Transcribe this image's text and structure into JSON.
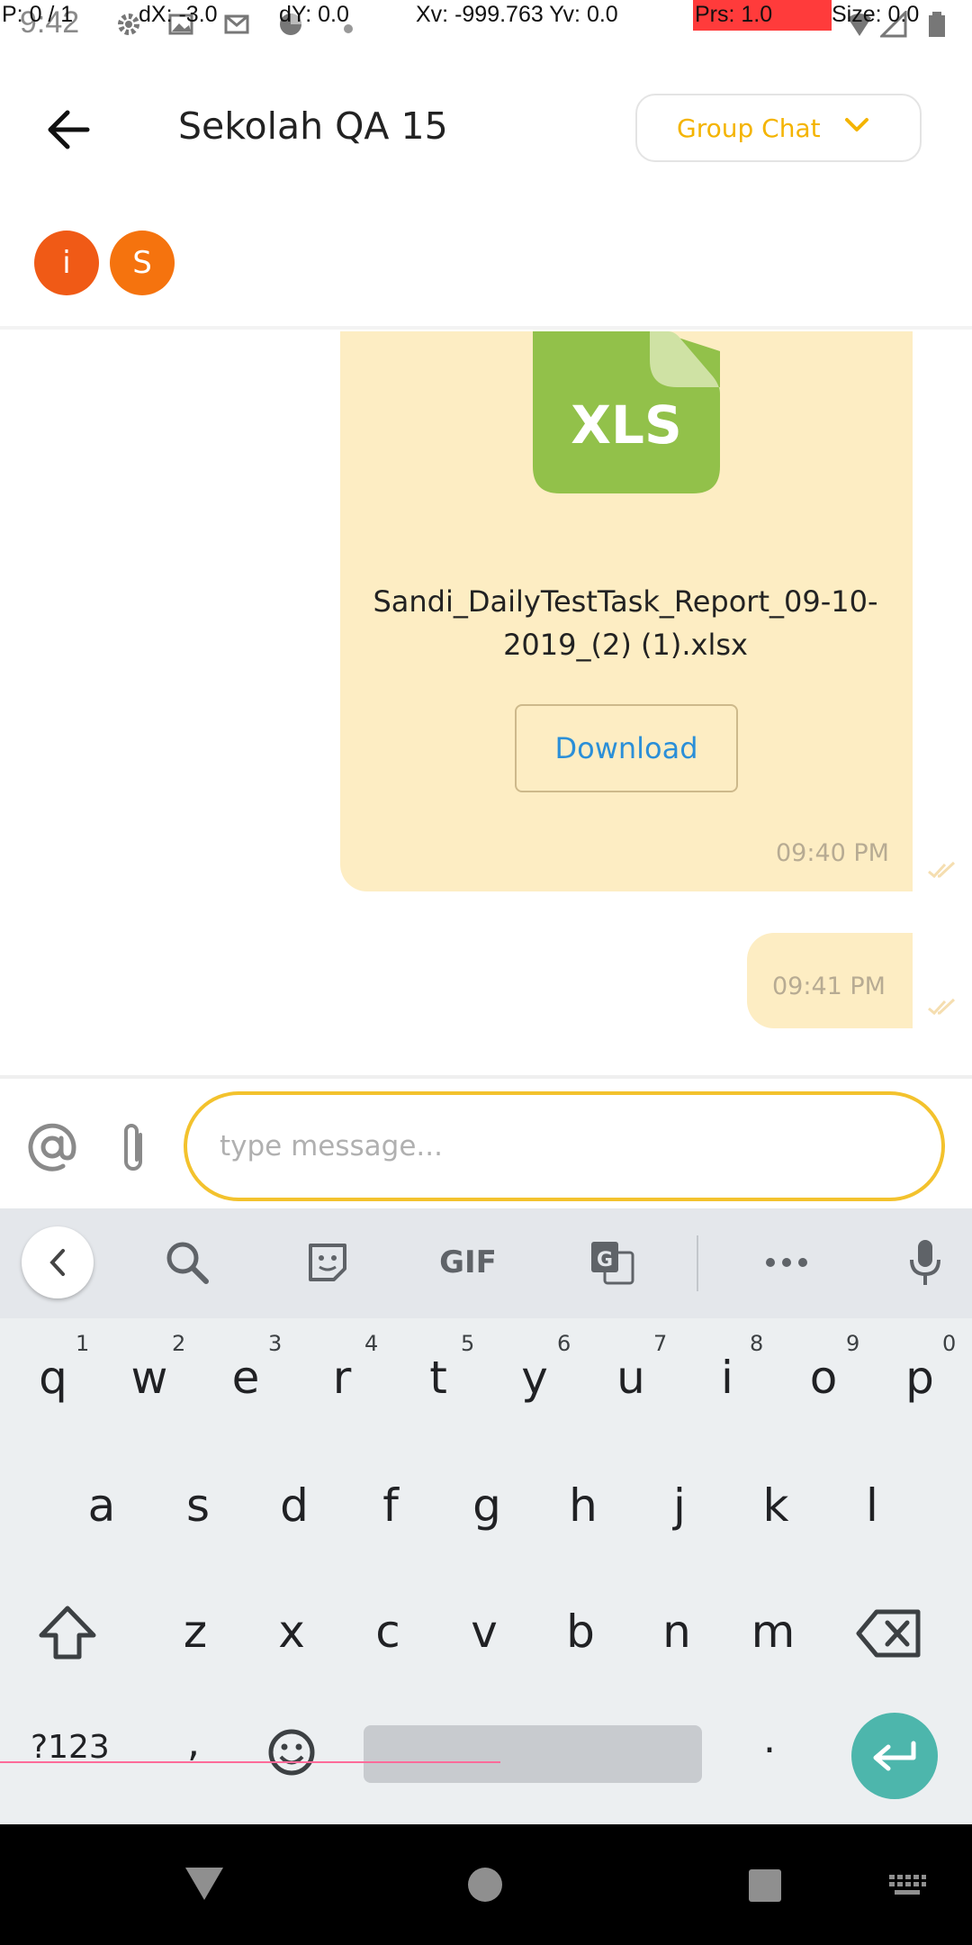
{
  "status_bar": {
    "time": "9:42",
    "debug": {
      "pointer": "P: 0 / 1",
      "dx": "dX: -3.0",
      "dy": "dY: 0.0",
      "velocity": "Xv: -999.763 Yv: 0.0",
      "pressure": "Prs: 1.0",
      "size": "Size: 0.0"
    }
  },
  "header": {
    "title": "Sekolah QA 15",
    "group_chat_label": "Group Chat"
  },
  "members": [
    {
      "initial": "i",
      "color": "#f05a16"
    },
    {
      "initial": "S",
      "color": "#f5730e"
    }
  ],
  "messages": [
    {
      "type": "file",
      "file_badge": "XLS",
      "file_name_line1": "Sandi_DailyTestTask_Report_09-10-",
      "file_name_line2": "2019_(2) (1).xlsx",
      "download_label": "Download",
      "time": "09:40 PM"
    },
    {
      "type": "text",
      "time": "09:41 PM"
    }
  ],
  "composer": {
    "placeholder": "type message...",
    "value": ""
  },
  "keyboard": {
    "toolbar_icons": [
      "chevron-left-icon",
      "search-icon",
      "sticker-icon",
      "gif-icon",
      "translate-icon",
      "more-icon",
      "mic-icon"
    ],
    "gif_label": "GIF",
    "row1": [
      "q",
      "w",
      "e",
      "r",
      "t",
      "y",
      "u",
      "i",
      "o",
      "p"
    ],
    "row1_hints": [
      "1",
      "2",
      "3",
      "4",
      "5",
      "6",
      "7",
      "8",
      "9",
      "0"
    ],
    "row2": [
      "a",
      "s",
      "d",
      "f",
      "g",
      "h",
      "j",
      "k",
      "l"
    ],
    "row3": [
      "z",
      "x",
      "c",
      "v",
      "b",
      "n",
      "m"
    ],
    "symbols_label": "?123",
    "comma": ",",
    "period": "."
  },
  "colors": {
    "accent": "#f4b400",
    "bubble": "#fdedc3",
    "link": "#2b8fd8",
    "enter": "#4db6ac",
    "xls": "#92c14a"
  }
}
